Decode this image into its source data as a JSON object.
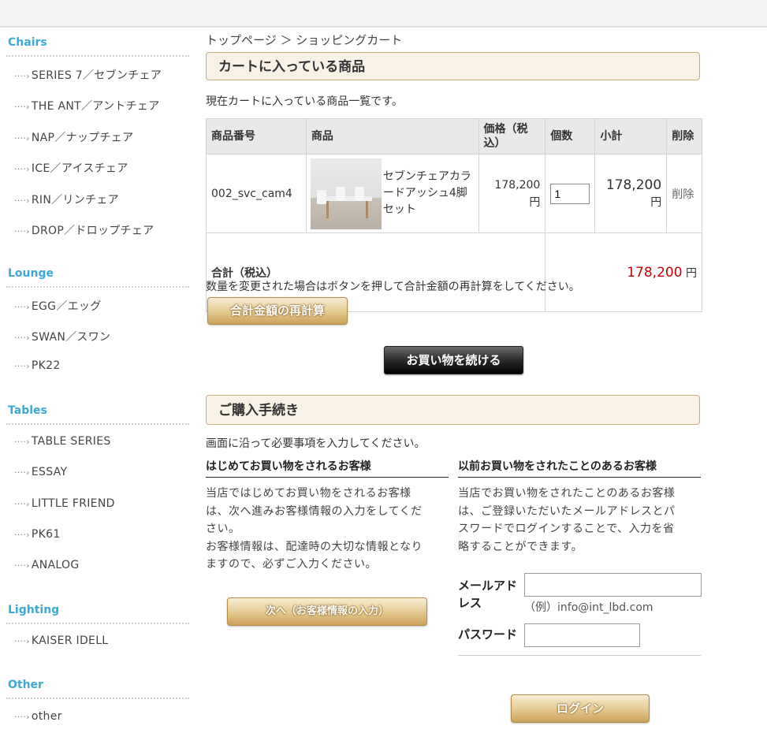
{
  "sidebar": {
    "categories": [
      {
        "title": "Chairs",
        "items": [
          "SERIES 7／セブンチェア",
          "THE ANT／アントチェア",
          "NAP／ナップチェア",
          "ICE／アイスチェア",
          "RIN／リンチェア",
          "DROP／ドロップチェア"
        ]
      },
      {
        "title": "Lounge",
        "items": [
          "EGG／エッグ",
          "SWAN／スワン",
          "PK22"
        ]
      },
      {
        "title": "Tables",
        "items": [
          "TABLE SERIES",
          "ESSAY",
          "LITTLE FRIEND",
          "PK61",
          "ANALOG"
        ]
      },
      {
        "title": "Lighting",
        "items": [
          "KAISER IDELL"
        ]
      },
      {
        "title": "Other",
        "items": [
          "other"
        ]
      }
    ],
    "arrow_glyph": "····›"
  },
  "breadcrumb": "トップページ ＞ ショッピングカート",
  "cart": {
    "heading": "カートに入っている商品",
    "intro": "現在カートに入っている商品一覧です。",
    "headers": {
      "code": "商品番号",
      "product": "商品",
      "price": "価格（税込）",
      "qty": "個数",
      "subtotal": "小計",
      "delete": "削除"
    },
    "row": {
      "code": "002_svc_cam4",
      "name": "セブンチェアカラードアッシュ4脚セット",
      "price": "178,200",
      "price_unit": "円",
      "qty": "1",
      "subtotal": "178,200",
      "subtotal_unit": "円",
      "delete": "削除"
    },
    "total_label": "合計（税込）",
    "total_value": "178,200",
    "total_unit": "円",
    "recalc_note": "数量を変更された場合はボタンを押して合計金額の再計算をしてください。",
    "recalc_button": "合計金額の再計算",
    "continue_button": "お買い物を続ける"
  },
  "checkout": {
    "heading": "ご購入手続き",
    "intro": "画面に沿って必要事項を入力してください。",
    "new_customer": {
      "title": "はじめてお買い物をされるお客様",
      "p1_l1": "当店ではじめてお買い物をされるお客様",
      "p1_l2": "は、次へ進みお客様情報の入力をしてくだ",
      "p1_l3": "さい。",
      "p2_l1": "お客様情報は、配達時の大切な情報となり",
      "p2_l2": "ますので、必ずご入力ください。",
      "button": "次へ（お客様情報の入力）"
    },
    "returning_customer": {
      "title": "以前お買い物をされたことのあるお客様",
      "p_l1": "当店でお買い物をされたことのあるお客様",
      "p_l2": "は、ご登録いただいたメールアドレスとパ",
      "p_l3": "スワードでログインすることで、入力を省",
      "p_l4": "略することができます。",
      "email_label_l1": "メールアド",
      "email_label_l2": "レス",
      "email_hint": "（例）info@int_lbd.com",
      "password_label": "パスワード",
      "login_button": "ログイン"
    }
  },
  "colors": {
    "accent_blue": "#3ca9d6",
    "price_red": "#cc0000",
    "gold": "#caa05a"
  }
}
